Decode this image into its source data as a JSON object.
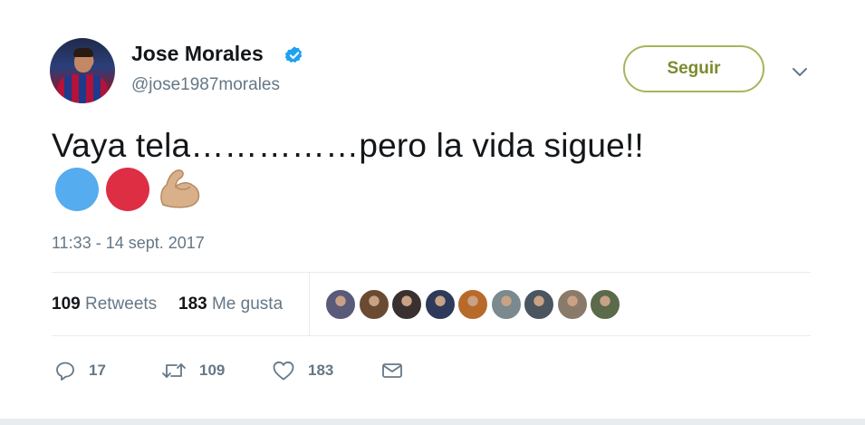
{
  "tweet": {
    "author": {
      "name": "Jose Morales",
      "handle": "@jose1987morales",
      "verified": true
    },
    "follow_label": "Seguir",
    "text": "Vaya tela……………pero la vida sigue!!",
    "emojis": [
      "blue-circle",
      "red-circle",
      "flexed-biceps"
    ],
    "timestamp": "11:33 - 14 sept. 2017",
    "stats": {
      "retweets_count": "109",
      "retweets_label": "Retweets",
      "likes_count": "183",
      "likes_label": "Me gusta"
    },
    "likers": [
      {
        "color": "#5a5a7a"
      },
      {
        "color": "#6b4a32"
      },
      {
        "color": "#3a3030"
      },
      {
        "color": "#2d3a5a"
      },
      {
        "color": "#b86a2a"
      },
      {
        "color": "#7a8a8e"
      },
      {
        "color": "#4a5560"
      },
      {
        "color": "#8a7a6a"
      },
      {
        "color": "#5a6a4a"
      }
    ],
    "actions": {
      "reply_count": "17",
      "retweet_count": "109",
      "like_count": "183"
    }
  },
  "colors": {
    "verified": "#1da1f2",
    "follow_border": "#aab35b",
    "follow_text": "#7d8a2e",
    "muted": "#657786"
  }
}
